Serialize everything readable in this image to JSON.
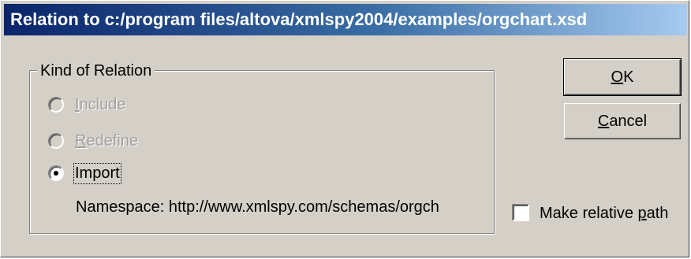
{
  "window": {
    "title": "Relation to c:/program files/altova/xmlspy2004/examples/orgchart.xsd"
  },
  "group": {
    "label": "Kind of Relation",
    "options": [
      {
        "first": "I",
        "rest": "nclude",
        "enabled": false,
        "selected": false
      },
      {
        "first": "R",
        "rest": "edefine",
        "enabled": false,
        "selected": false
      },
      {
        "first": "",
        "rest": "Import",
        "enabled": true,
        "selected": true
      }
    ],
    "namespace_text": "Namespace: http://www.xmlspy.com/schemas/orgch"
  },
  "buttons": {
    "ok": {
      "mnemonic": "O",
      "rest": "K"
    },
    "cancel": {
      "mnemonic": "C",
      "rest": "ancel"
    }
  },
  "relative_path": {
    "before": "Make relative ",
    "mnemonic": "p",
    "after": "ath",
    "checked": false
  }
}
